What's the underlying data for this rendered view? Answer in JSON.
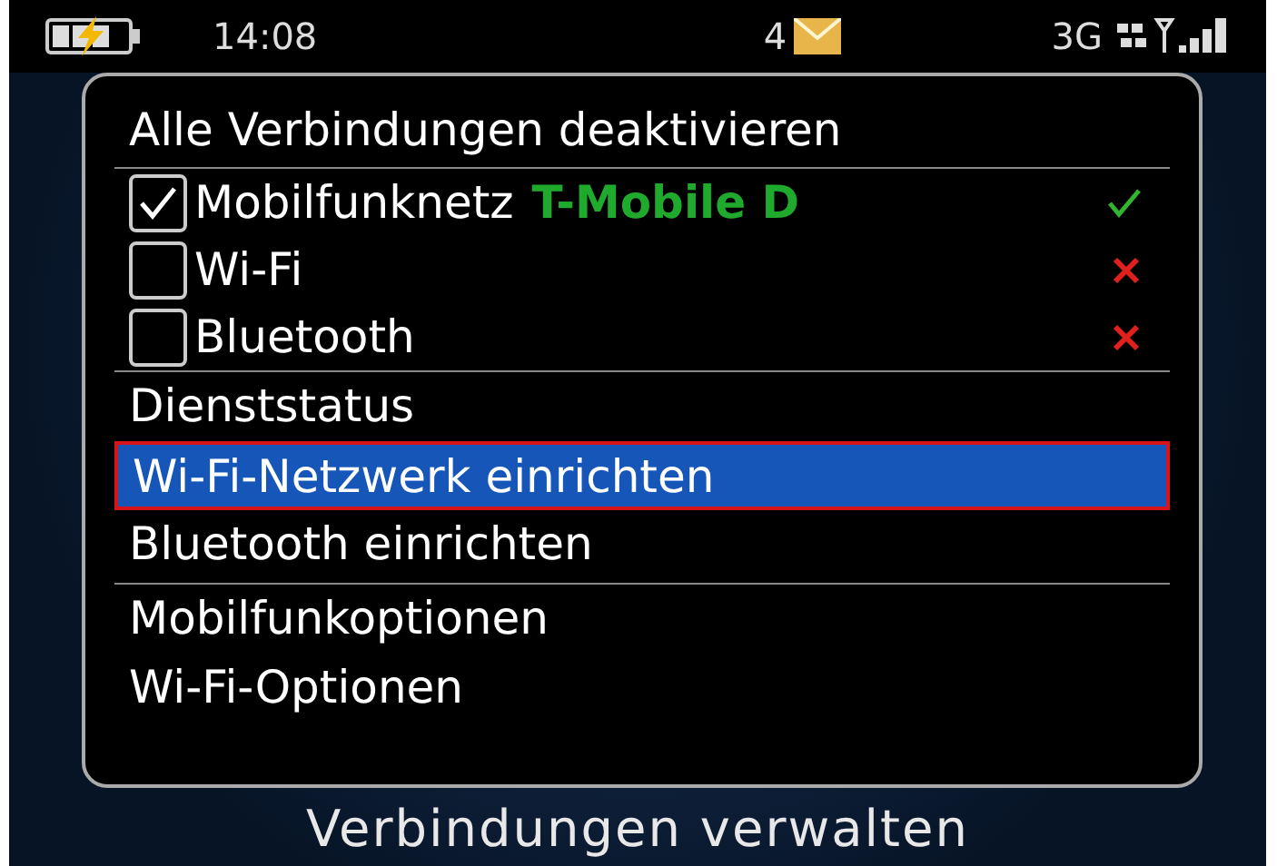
{
  "status_bar": {
    "time": "14:08",
    "message_count": "4",
    "network": "3G"
  },
  "menu": {
    "top_item": "Alle Verbindungen deaktivieren",
    "connections": [
      {
        "label": "Mobilfunknetz",
        "carrier": "T-Mobile D",
        "checked": true,
        "on": true
      },
      {
        "label": "Wi-Fi",
        "checked": false,
        "on": false
      },
      {
        "label": "Bluetooth",
        "checked": false,
        "on": false
      }
    ],
    "item_groups": [
      [
        {
          "label": "Dienststatus",
          "selected": false
        },
        {
          "label": "Wi-Fi-Netzwerk einrichten",
          "selected": true
        },
        {
          "label": "Bluetooth einrichten",
          "selected": false
        }
      ],
      [
        {
          "label": "Mobilfunkoptionen",
          "selected": false
        },
        {
          "label": "Wi-Fi-Optionen",
          "selected": false
        }
      ]
    ]
  },
  "screen_title": "Verbindungen verwalten"
}
